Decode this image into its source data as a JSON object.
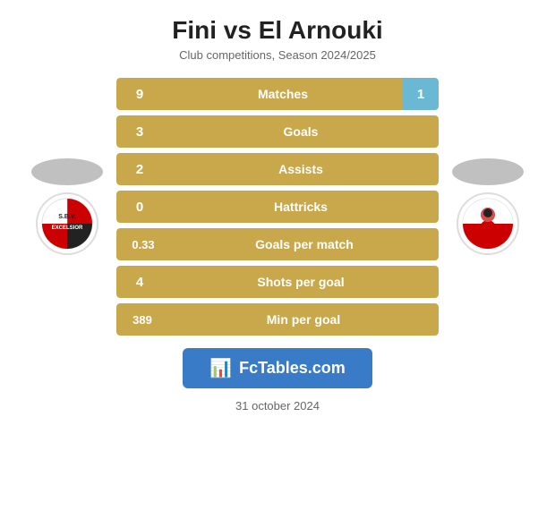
{
  "header": {
    "title": "Fini vs El Arnouki",
    "subtitle": "Club competitions, Season 2024/2025"
  },
  "stats": [
    {
      "label": "Matches",
      "left": "9",
      "right": "1",
      "has_right": true
    },
    {
      "label": "Goals",
      "left": "3",
      "right": null,
      "has_right": false
    },
    {
      "label": "Assists",
      "left": "2",
      "right": null,
      "has_right": false
    },
    {
      "label": "Hattricks",
      "left": "0",
      "right": null,
      "has_right": false
    },
    {
      "label": "Goals per match",
      "left": "0.33",
      "right": null,
      "has_right": false
    },
    {
      "label": "Shots per goal",
      "left": "4",
      "right": null,
      "has_right": false
    },
    {
      "label": "Min per goal",
      "left": "389",
      "right": null,
      "has_right": false
    }
  ],
  "fctables": {
    "label": "FcTables.com"
  },
  "footer": {
    "date": "31 october 2024"
  }
}
